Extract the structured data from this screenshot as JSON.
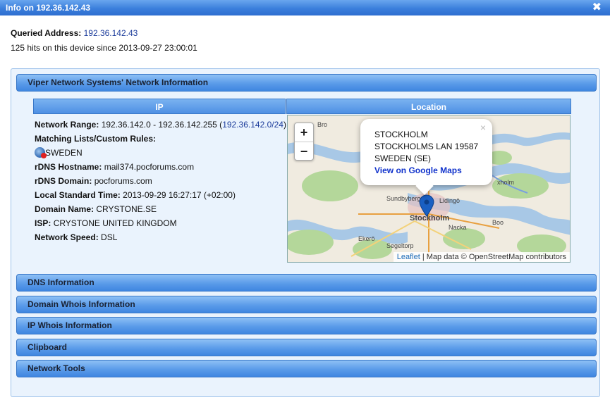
{
  "window": {
    "title": "Info on 192.36.142.43",
    "close_label": "✖"
  },
  "query": {
    "label": "Queried Address:",
    "address": "192.36.142.43",
    "hits_text": "125 hits on this device since 2013-09-27 23:00:01"
  },
  "sections": {
    "viper": "Viper Network Systems' Network Information",
    "dns": "DNS Information",
    "domain_whois": "Domain Whois Information",
    "ip_whois": "IP Whois Information",
    "clipboard": "Clipboard",
    "network_tools": "Network Tools"
  },
  "columns": {
    "ip": "IP",
    "location": "Location"
  },
  "info": {
    "network_range_label": "Network Range:",
    "network_range_value": "192.36.142.0 - 192.36.142.255 (",
    "network_range_link": "192.36.142.0/24",
    "network_range_close": ")",
    "matching_label": "Matching Lists/Custom Rules:",
    "country": "SWEDEN",
    "rdns_hostname_label": "rDNS Hostname:",
    "rdns_hostname_value": "mail374.pocforums.com",
    "rdns_domain_label": "rDNS Domain:",
    "rdns_domain_value": "pocforums.com",
    "local_time_label": "Local Standard Time:",
    "local_time_value": "2013-09-29 16:27:17 (+02:00)",
    "domain_name_label": "Domain Name:",
    "domain_name_value": "CRYSTONE.SE",
    "isp_label": "ISP:",
    "isp_value": "CRYSTONE UNITED KINGDOM",
    "speed_label": "Network Speed:",
    "speed_value": "DSL"
  },
  "map": {
    "zoom_in": "+",
    "zoom_out": "−",
    "popup": {
      "line1": "STOCKHOLM",
      "line2": "STOCKHOLMS LAN 19587",
      "line3": "SWEDEN (SE)",
      "link": "View on Google Maps",
      "close": "×"
    },
    "attribution_link": "Leaflet",
    "attribution_text": " | Map data © OpenStreetMap contributors",
    "place_labels": {
      "bro": "Bro",
      "sundbyberg": "Sundbyberg",
      "lidingo": "Lidingö",
      "stockholm": "Stockholm",
      "nacka": "Nacka",
      "boo": "Boo",
      "ekero": "Ekerö",
      "segeltorp": "Segeltorp",
      "vaxholm": "xholm"
    },
    "colors": {
      "water": "#a8c8e6",
      "land": "#f0ebe0",
      "forest": "#b4d79a",
      "marker": "#1a5fc2"
    }
  }
}
